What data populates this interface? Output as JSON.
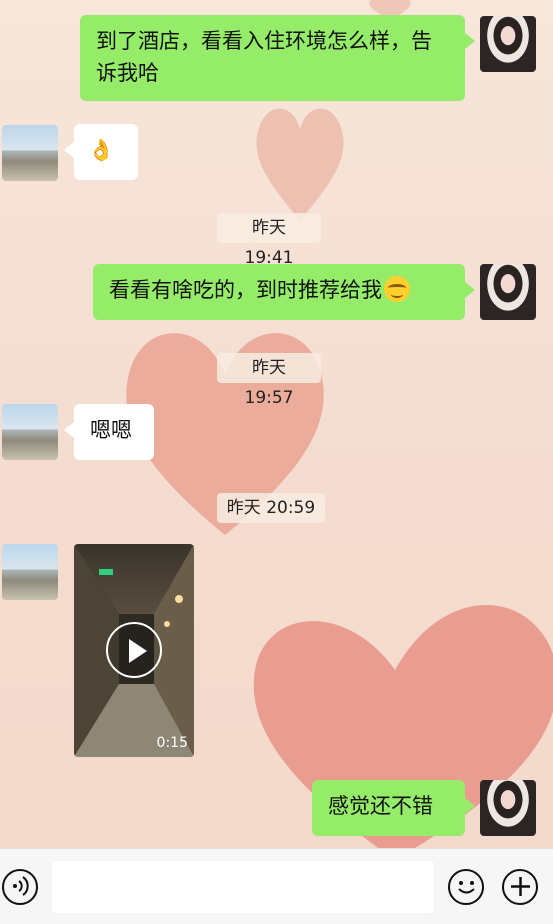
{
  "messages": [
    {
      "text": "到了酒店，看看入住环境怎么样，告诉我哈"
    },
    {
      "emoji": "👌"
    },
    {
      "time": "昨天 19:41"
    },
    {
      "text": "看看有啥吃的，到时推荐给我"
    },
    {
      "time": "昨天 19:57"
    },
    {
      "text": "嗯嗯"
    },
    {
      "time": "昨天 20:59"
    },
    {
      "video_duration": "0:15"
    },
    {
      "text": "感觉还不错"
    }
  ],
  "colors": {
    "self_bubble": "#95ec69",
    "other_bubble": "#ffffff"
  },
  "icons": {
    "voice": "voice-icon",
    "emoji": "emoji-icon",
    "plus": "plus-icon"
  }
}
